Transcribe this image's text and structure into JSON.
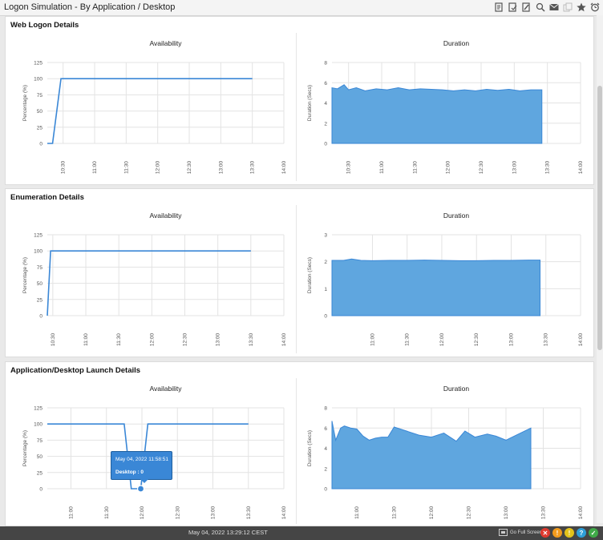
{
  "window": {
    "title": "Logon Simulation - By Application / Desktop",
    "toolbar_icons": [
      "report-icon",
      "export-icon",
      "edit-icon",
      "search-icon",
      "mail-icon",
      "copy-icon",
      "star-icon",
      "alarm-icon"
    ]
  },
  "colors": {
    "accent": "#3a87d6",
    "area": "#5fa6df",
    "line": "#3a87d6",
    "grid": "#e3e3e3"
  },
  "sections": [
    {
      "title": "Web Logon Details"
    },
    {
      "title": "Enumeration Details"
    },
    {
      "title": "Application/Desktop Launch Details"
    }
  ],
  "tooltip": {
    "date": "May 04, 2022 11:58:51",
    "value": "Desktop : 0"
  },
  "status": {
    "timestamp": "May 04, 2022 13:29:12 CEST",
    "full_screen": "Go Full Screen",
    "indicators": [
      {
        "name": "critical",
        "glyph": "✕",
        "color": "#e03a2f"
      },
      {
        "name": "warning",
        "glyph": "!",
        "color": "#f29b1d"
      },
      {
        "name": "minor",
        "glyph": "!",
        "color": "#e3c21a"
      },
      {
        "name": "help",
        "glyph": "?",
        "color": "#2e9fd8"
      },
      {
        "name": "ok",
        "glyph": "✓",
        "color": "#3faa48"
      }
    ]
  },
  "chart_data": [
    {
      "type": "line",
      "title": "Availability",
      "ylabel": "Percentage (%)",
      "ylim": [
        0,
        125
      ],
      "yticks": [
        0,
        25,
        50,
        75,
        100,
        125
      ],
      "xlim": [
        "10:15",
        "14:00"
      ],
      "xticks": [
        "10:30",
        "11:00",
        "11:30",
        "12:00",
        "12:30",
        "13:00",
        "13:30",
        "14:00"
      ],
      "series": [
        {
          "x": [
            "10:15",
            "10:20",
            "10:28",
            "13:30"
          ],
          "y": [
            0,
            0,
            100,
            100
          ]
        }
      ]
    },
    {
      "type": "area",
      "title": "Duration",
      "ylabel": "Duration (Secs)",
      "ylim": [
        0,
        8
      ],
      "yticks": [
        0,
        2,
        4,
        6,
        8
      ],
      "xlim": [
        "10:15",
        "14:00"
      ],
      "xticks": [
        "10:30",
        "11:00",
        "11:30",
        "12:00",
        "12:30",
        "13:00",
        "13:30",
        "14:00"
      ],
      "series": [
        {
          "x": [
            "10:15",
            "10:20",
            "10:26",
            "10:30",
            "10:37",
            "10:45",
            "10:55",
            "11:05",
            "11:15",
            "11:25",
            "11:35",
            "11:45",
            "11:55",
            "12:05",
            "12:15",
            "12:25",
            "12:35",
            "12:45",
            "12:55",
            "13:05",
            "13:15",
            "13:25"
          ],
          "y": [
            5.5,
            5.4,
            5.8,
            5.3,
            5.5,
            5.2,
            5.4,
            5.3,
            5.5,
            5.3,
            5.4,
            5.35,
            5.3,
            5.2,
            5.3,
            5.2,
            5.35,
            5.25,
            5.35,
            5.2,
            5.3,
            5.3
          ]
        }
      ]
    },
    {
      "type": "line",
      "title": "Availability",
      "ylabel": "Percentage (%)",
      "ylim": [
        0,
        125
      ],
      "yticks": [
        0,
        25,
        50,
        75,
        100,
        125
      ],
      "xlim": [
        "10:25",
        "14:00"
      ],
      "xticks": [
        "10:30",
        "11:00",
        "11:30",
        "12:00",
        "12:30",
        "13:00",
        "13:30",
        "14:00"
      ],
      "series": [
        {
          "x": [
            "10:25",
            "10:28",
            "13:30"
          ],
          "y": [
            0,
            100,
            100
          ]
        }
      ]
    },
    {
      "type": "area",
      "title": "Duration",
      "ylabel": "Duration (Secs)",
      "ylim": [
        0,
        3
      ],
      "yticks": [
        0,
        1,
        2,
        3
      ],
      "xlim": [
        "10:25",
        "14:00"
      ],
      "xticks": [
        "11:00",
        "11:30",
        "12:00",
        "12:30",
        "13:00",
        "13:30",
        "14:00"
      ],
      "series": [
        {
          "x": [
            "10:25",
            "10:35",
            "10:42",
            "10:50",
            "11:00",
            "11:15",
            "11:30",
            "11:45",
            "12:00",
            "12:15",
            "12:30",
            "12:45",
            "13:00",
            "13:15",
            "13:25"
          ],
          "y": [
            2.05,
            2.05,
            2.1,
            2.05,
            2.04,
            2.05,
            2.05,
            2.06,
            2.05,
            2.04,
            2.04,
            2.05,
            2.05,
            2.06,
            2.06
          ]
        }
      ]
    },
    {
      "type": "line",
      "title": "Availability",
      "ylabel": "Percentage (%)",
      "ylim": [
        0,
        125
      ],
      "yticks": [
        0,
        25,
        50,
        75,
        100,
        125
      ],
      "xlim": [
        "10:40",
        "14:00"
      ],
      "xticks": [
        "11:00",
        "11:30",
        "12:00",
        "12:30",
        "13:00",
        "13:30",
        "14:00"
      ],
      "series": [
        {
          "x": [
            "10:40",
            "11:45",
            "11:51",
            "11:59",
            "12:05",
            "13:30"
          ],
          "y": [
            100,
            100,
            0,
            0,
            100,
            100
          ]
        }
      ],
      "highlight": {
        "x": "11:59",
        "y": 0
      }
    },
    {
      "type": "area",
      "title": "Duration",
      "ylabel": "Duration (Secs)",
      "ylim": [
        0,
        8
      ],
      "yticks": [
        0,
        2,
        4,
        6,
        8
      ],
      "xlim": [
        "10:40",
        "14:00"
      ],
      "xticks": [
        "11:00",
        "11:30",
        "12:00",
        "12:30",
        "13:00",
        "13:30",
        "14:00"
      ],
      "series": [
        {
          "x": [
            "10:40",
            "10:43",
            "10:47",
            "10:50",
            "10:55",
            "11:00",
            "11:05",
            "11:10",
            "11:15",
            "11:20",
            "11:25",
            "11:30",
            "11:40",
            "11:50",
            "12:00",
            "12:10",
            "12:20",
            "12:27",
            "12:35",
            "12:45",
            "12:52",
            "13:00",
            "13:10",
            "13:20"
          ],
          "y": [
            6.7,
            4.8,
            6.0,
            6.2,
            6.0,
            5.9,
            5.2,
            4.8,
            5.0,
            5.1,
            5.1,
            6.1,
            5.7,
            5.3,
            5.1,
            5.5,
            4.7,
            5.7,
            5.1,
            5.4,
            5.2,
            4.8,
            5.4,
            6.0
          ]
        }
      ]
    }
  ]
}
